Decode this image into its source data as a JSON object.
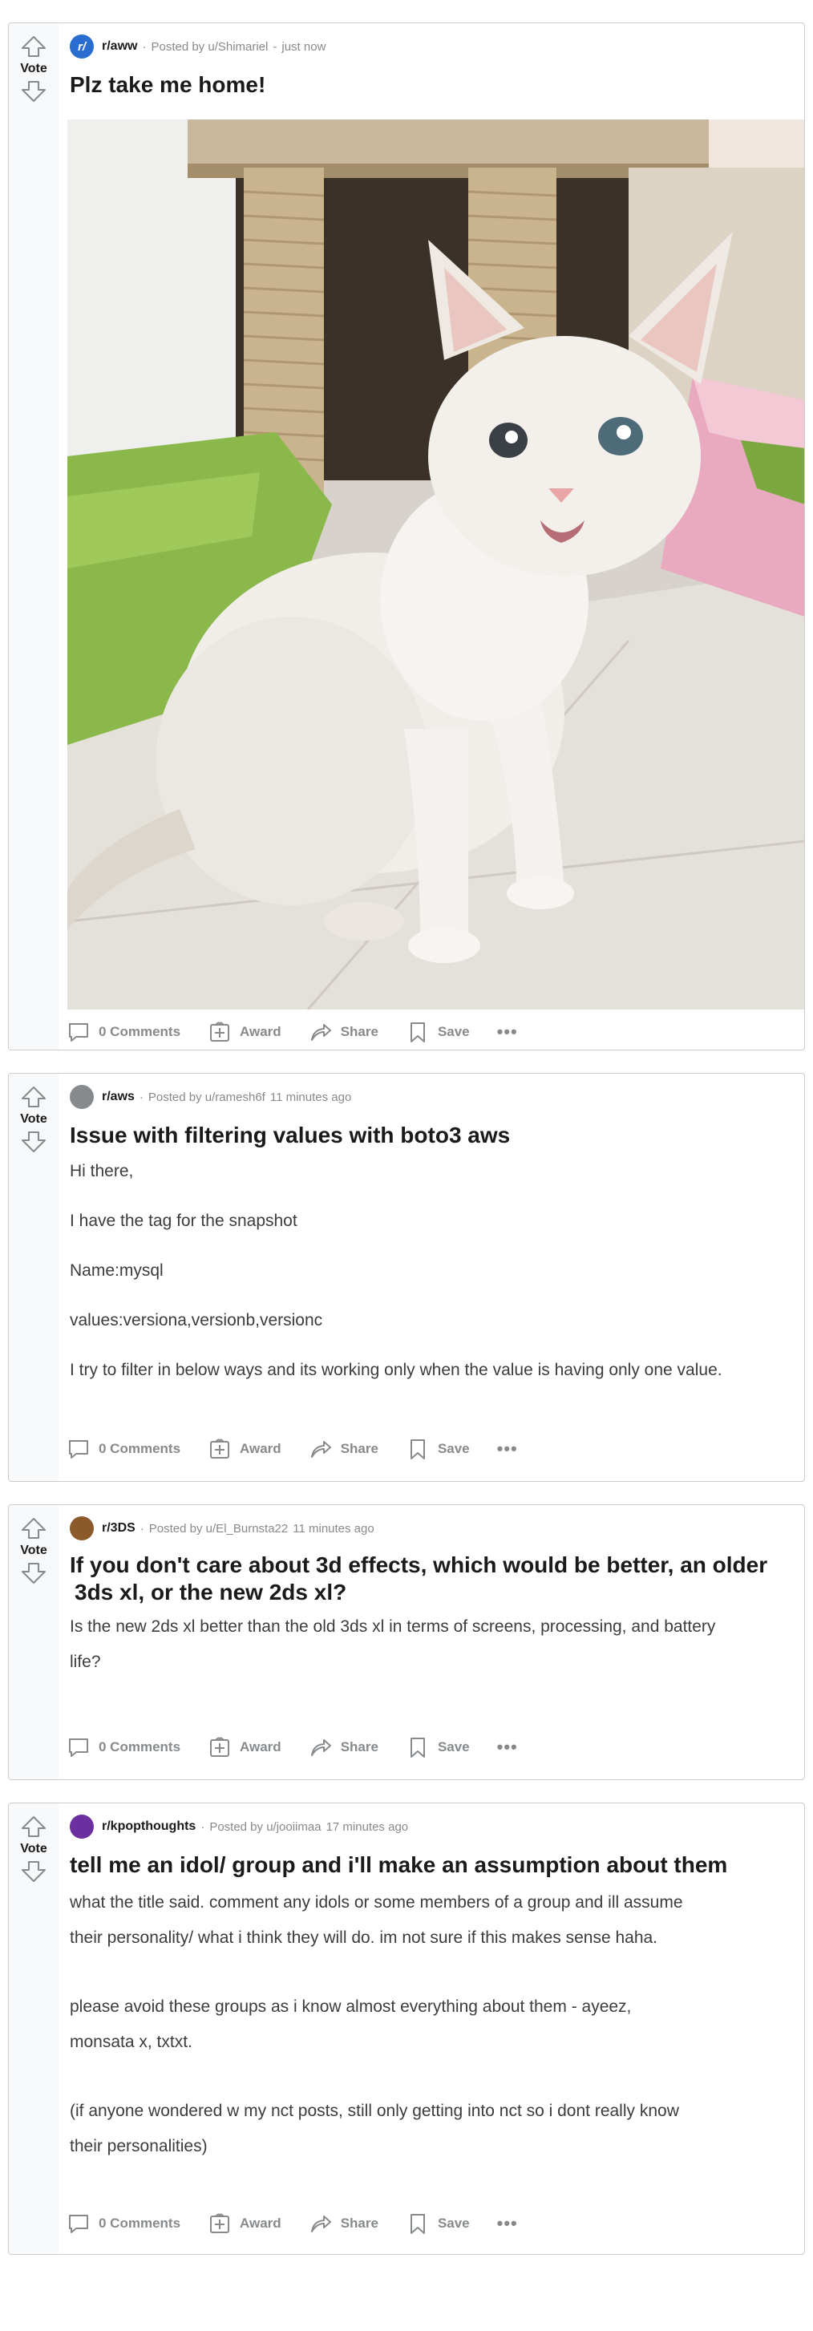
{
  "colors": {
    "accent_aww": "#2a6dd0",
    "accent_aws": "#878a8c",
    "accent_3ds": "#8b5a2b",
    "accent_kpop": "#6b2fa0"
  },
  "vote_label": "Vote",
  "actions": {
    "comments": "0 Comments",
    "award": "Award",
    "share": "Share",
    "save": "Save",
    "more": "•••"
  },
  "posts": [
    {
      "icon_letter": "r/",
      "subreddit": "r/aww",
      "posted_by": "Posted by u/Shimariel",
      "time": "just now",
      "title": "Plz take me home!",
      "image": "white-kitten-photo"
    },
    {
      "subreddit": "r/aws",
      "posted_by": "Posted by u/ramesh6f",
      "time": "11 minutes ago",
      "title": "Issue with filtering values with boto3 aws",
      "body": [
        "Hi there,",
        "I have the tag for the snapshot",
        "Name:mysql",
        "values:versiona,versionb,versionc",
        "I try to filter in below ways and its working only when the value is having only one value."
      ]
    },
    {
      "subreddit": "r/3DS",
      "posted_by": "Posted by u/El_Burnsta22",
      "time": "11 minutes ago",
      "title_line1": "If you don't care about 3d effects, which would be better, an older",
      "title_line2": "3ds xl, or the new 2ds xl?",
      "body_line1": "Is the new 2ds xl better than the old 3ds xl in terms of screens, processing, and battery",
      "body_line2": "life?"
    },
    {
      "subreddit": "r/kpopthoughts",
      "posted_by": "Posted by u/jooiimaa",
      "time": "17 minutes ago",
      "title": "tell me an idol/ group and i'll make an assumption about them",
      "para1_line1": "what the title said. comment any idols or some members of a group and ill assume",
      "para1_line2": "their personality/ what i think they will do. im not sure if this makes sense haha.",
      "para2_line1": "please avoid these groups as i know almost everything about them - ayeez,",
      "para2_line2": "monsata x, txtxt.",
      "para3_line1": "(if anyone wondered w my nct posts, still only getting into nct so i dont really know",
      "para3_line2": "their personalities)"
    }
  ]
}
